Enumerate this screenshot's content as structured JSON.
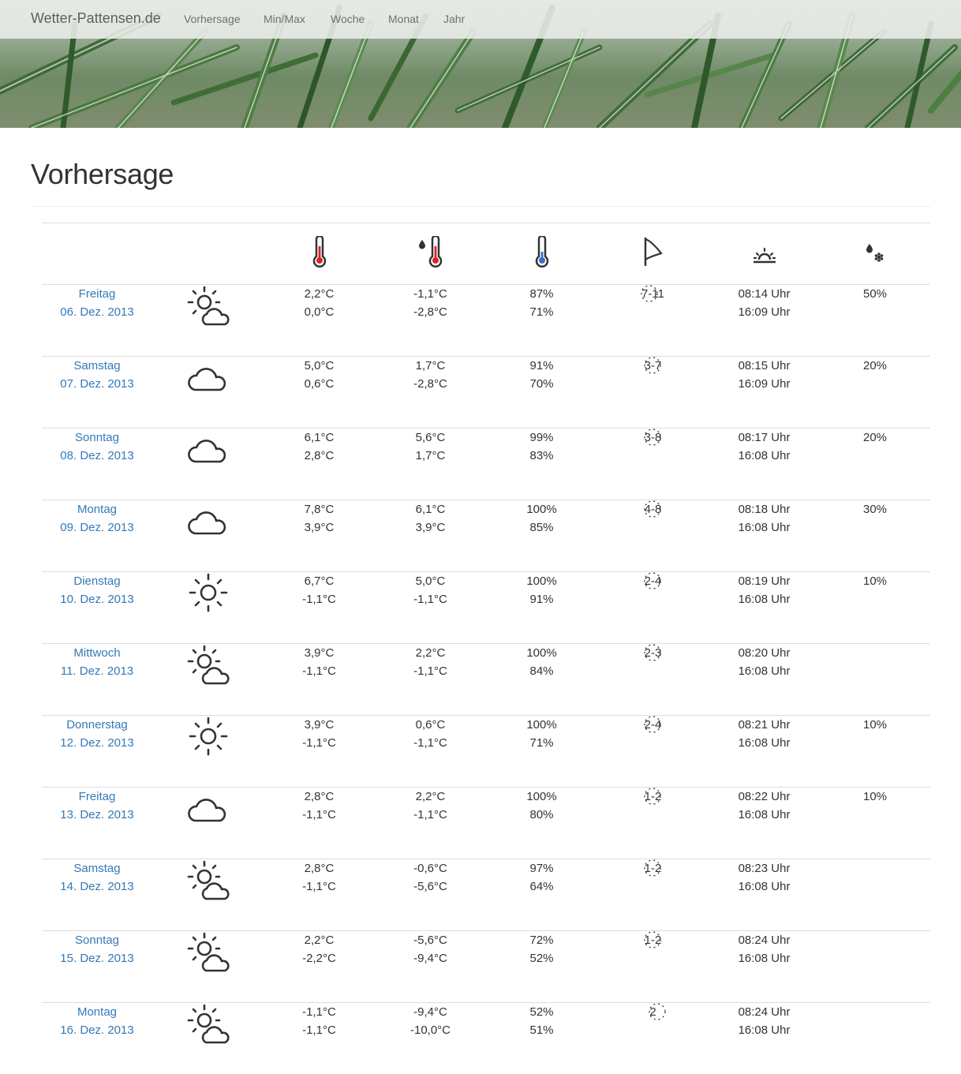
{
  "navbar": {
    "brand": "Wetter-Pattensen.de",
    "links": [
      "Vorhersage",
      "Min/Max",
      "Woche",
      "Monat",
      "Jahr"
    ]
  },
  "page": {
    "title": "Vorhersage"
  },
  "header_icons": [
    "thermometer-red-icon",
    "dew-thermometer-icon",
    "thermometer-blue-icon",
    "wind-flag-icon",
    "sunrise-icon",
    "precipitation-icon"
  ],
  "colors": {
    "link": "#337ab7",
    "text": "#333333",
    "thermo_red": "#d6262c",
    "thermo_blue": "#3a6fc4"
  },
  "forecast": [
    {
      "weekday": "Freitag",
      "date": "06. Dez. 2013",
      "icon": "partly-cloudy-icon",
      "temp_max": "2,2°C",
      "temp_min": "0,0°C",
      "feel_max": "-1,1°C",
      "feel_min": "-2,8°C",
      "hum_max": "87%",
      "hum_min": "71%",
      "wind": "7-11",
      "sunrise": "08:14 Uhr",
      "sunset": "16:09 Uhr",
      "precip": "50%"
    },
    {
      "weekday": "Samstag",
      "date": "07. Dez. 2013",
      "icon": "cloud-icon",
      "temp_max": "5,0°C",
      "temp_min": "0,6°C",
      "feel_max": "1,7°C",
      "feel_min": "-2,8°C",
      "hum_max": "91%",
      "hum_min": "70%",
      "wind": "3-7",
      "sunrise": "08:15 Uhr",
      "sunset": "16:09 Uhr",
      "precip": "20%"
    },
    {
      "weekday": "Sonntag",
      "date": "08. Dez. 2013",
      "icon": "cloud-icon",
      "temp_max": "6,1°C",
      "temp_min": "2,8°C",
      "feel_max": "5,6°C",
      "feel_min": "1,7°C",
      "hum_max": "99%",
      "hum_min": "83%",
      "wind": "3-8",
      "sunrise": "08:17 Uhr",
      "sunset": "16:08 Uhr",
      "precip": "20%"
    },
    {
      "weekday": "Montag",
      "date": "09. Dez. 2013",
      "icon": "cloud-icon",
      "temp_max": "7,8°C",
      "temp_min": "3,9°C",
      "feel_max": "6,1°C",
      "feel_min": "3,9°C",
      "hum_max": "100%",
      "hum_min": "85%",
      "wind": "4-8",
      "sunrise": "08:18 Uhr",
      "sunset": "16:08 Uhr",
      "precip": "30%"
    },
    {
      "weekday": "Dienstag",
      "date": "10. Dez. 2013",
      "icon": "sun-icon",
      "temp_max": "6,7°C",
      "temp_min": "-1,1°C",
      "feel_max": "5,0°C",
      "feel_min": "-1,1°C",
      "hum_max": "100%",
      "hum_min": "91%",
      "wind": "2-4",
      "sunrise": "08:19 Uhr",
      "sunset": "16:08 Uhr",
      "precip": "10%"
    },
    {
      "weekday": "Mittwoch",
      "date": "11. Dez. 2013",
      "icon": "partly-cloudy-icon",
      "temp_max": "3,9°C",
      "temp_min": "-1,1°C",
      "feel_max": "2,2°C",
      "feel_min": "-1,1°C",
      "hum_max": "100%",
      "hum_min": "84%",
      "wind": "2-3",
      "sunrise": "08:20 Uhr",
      "sunset": "16:08 Uhr",
      "precip": ""
    },
    {
      "weekday": "Donnerstag",
      "date": "12. Dez. 2013",
      "icon": "sun-icon",
      "temp_max": "3,9°C",
      "temp_min": "-1,1°C",
      "feel_max": "0,6°C",
      "feel_min": "-1,1°C",
      "hum_max": "100%",
      "hum_min": "71%",
      "wind": "2-4",
      "sunrise": "08:21 Uhr",
      "sunset": "16:08 Uhr",
      "precip": "10%"
    },
    {
      "weekday": "Freitag",
      "date": "13. Dez. 2013",
      "icon": "cloud-icon",
      "temp_max": "2,8°C",
      "temp_min": "-1,1°C",
      "feel_max": "2,2°C",
      "feel_min": "-1,1°C",
      "hum_max": "100%",
      "hum_min": "80%",
      "wind": "1-2",
      "sunrise": "08:22 Uhr",
      "sunset": "16:08 Uhr",
      "precip": "10%"
    },
    {
      "weekday": "Samstag",
      "date": "14. Dez. 2013",
      "icon": "partly-cloudy-icon",
      "temp_max": "2,8°C",
      "temp_min": "-1,1°C",
      "feel_max": "-0,6°C",
      "feel_min": "-5,6°C",
      "hum_max": "97%",
      "hum_min": "64%",
      "wind": "1-2",
      "sunrise": "08:23 Uhr",
      "sunset": "16:08 Uhr",
      "precip": ""
    },
    {
      "weekday": "Sonntag",
      "date": "15. Dez. 2013",
      "icon": "partly-cloudy-icon",
      "temp_max": "2,2°C",
      "temp_min": "-2,2°C",
      "feel_max": "-5,6°C",
      "feel_min": "-9,4°C",
      "hum_max": "72%",
      "hum_min": "52%",
      "wind": "1-2",
      "sunrise": "08:24 Uhr",
      "sunset": "16:08 Uhr",
      "precip": ""
    },
    {
      "weekday": "Montag",
      "date": "16. Dez. 2013",
      "icon": "partly-cloudy-icon",
      "temp_max": "-1,1°C",
      "temp_min": "-1,1°C",
      "feel_max": "-9,4°C",
      "feel_min": "-10,0°C",
      "hum_max": "52%",
      "hum_min": "51%",
      "wind": "2",
      "sunrise": "08:24 Uhr",
      "sunset": "16:08 Uhr",
      "precip": ""
    }
  ]
}
